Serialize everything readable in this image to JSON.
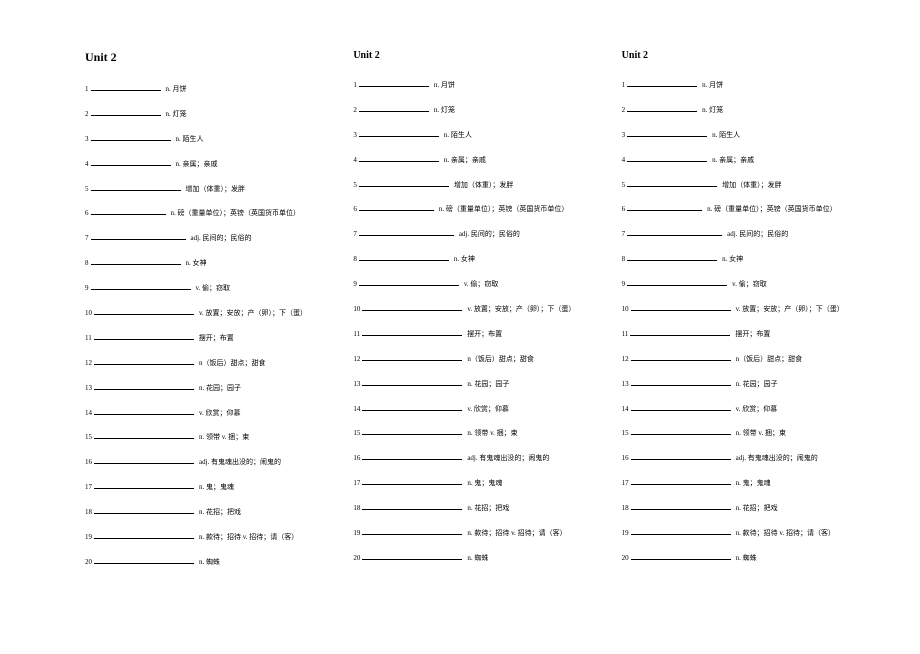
{
  "columns": [
    {
      "title": "Unit 2",
      "titleClass": "unit-title main"
    },
    {
      "title": "Unit 2",
      "titleClass": "unit-title"
    },
    {
      "title": "Unit 2",
      "titleClass": "unit-title"
    }
  ],
  "items": [
    {
      "num": "1",
      "blank": 70,
      "def": "n. 月饼"
    },
    {
      "num": "2",
      "blank": 70,
      "def": "n. 灯笼"
    },
    {
      "num": "3",
      "blank": 80,
      "def": "n. 陌生人"
    },
    {
      "num": "4",
      "blank": 80,
      "def": "n. 亲属；亲戚"
    },
    {
      "num": "5",
      "blank": 90,
      "def": "增加（体重）；发胖"
    },
    {
      "num": "6",
      "blank": 75,
      "def": "n. 磅（重量单位）；英镑（英国货币单位）"
    },
    {
      "num": "7",
      "blank": 95,
      "def": "adj. 民间的；民俗的"
    },
    {
      "num": "8",
      "blank": 90,
      "def": "n. 女神"
    },
    {
      "num": "9",
      "blank": 100,
      "def": "v. 偷；窃取"
    },
    {
      "num": "10",
      "blank": 100,
      "def": "v. 放置；安放；产（卵）；下（蛋）"
    },
    {
      "num": "11",
      "blank": 100,
      "def": "摆开；布置"
    },
    {
      "num": "12",
      "blank": 100,
      "def": "n（饭后）甜点；甜食"
    },
    {
      "num": "13",
      "blank": 100,
      "def": "n. 花园；园子"
    },
    {
      "num": "14",
      "blank": 100,
      "def": "v. 欣赏；仰慕"
    },
    {
      "num": "15",
      "blank": 100,
      "def": "n. 领带 v. 捆；束"
    },
    {
      "num": "16",
      "blank": 100,
      "def": "adj. 有鬼魂出没的；闹鬼的"
    },
    {
      "num": "17",
      "blank": 100,
      "def": "n. 鬼；鬼魂"
    },
    {
      "num": "18",
      "blank": 100,
      "def": "n. 花招；把戏"
    },
    {
      "num": "19",
      "blank": 100,
      "def": "n. 款待；招待 v. 招待；请（客）"
    },
    {
      "num": "20",
      "blank": 100,
      "def": "n. 蜘蛛"
    }
  ]
}
